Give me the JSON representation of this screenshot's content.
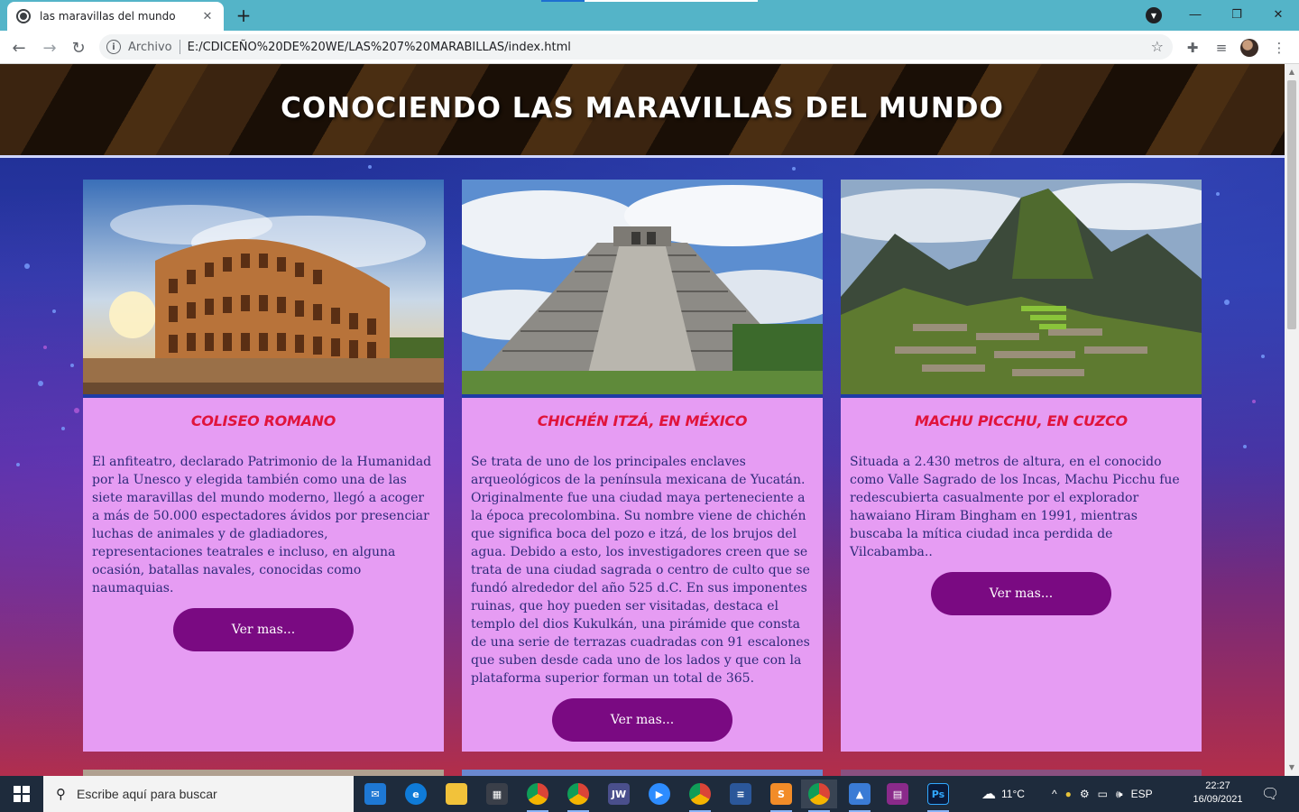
{
  "browser": {
    "tab_title": "las maravillas del mundo",
    "tab_close": "✕",
    "new_tab": "+",
    "scheme_label": "Archivo",
    "url": "E:/CDICEÑO%20DE%20WE/LAS%207%20MARABILLAS/index.html"
  },
  "page": {
    "title": "CONOCIENDO LAS MARAVILLAS DEL MUNDO",
    "cards": [
      {
        "heading": "COLISEO ROMANO",
        "text": "El anfiteatro, declarado Patrimonio de la Humanidad por la Unesco y elegida también como una de las siete maravillas del mundo moderno, llegó a acoger a más de 50.000 espectadores ávidos por presenciar luchas de animales y de gladiadores, representaciones teatrales e incluso, en alguna ocasión, batallas navales, conocidas como naumaquias.",
        "button": "Ver mas..."
      },
      {
        "heading": "CHICHÉN ITZÁ, EN MÉXICO",
        "text": "Se trata de uno de los principales enclaves arqueológicos de la península mexicana de Yucatán. Originalmente fue una ciudad maya perteneciente a la época precolombina. Su nombre viene de chichén que significa boca del pozo e itzá, de los brujos del agua. Debido a esto, los investigadores creen que se trata de una ciudad sagrada o centro de culto que se fundó alrededor del año 525 d.C. En sus imponentes ruinas, que hoy pueden ser visitadas, destaca el templo del dios Kukulkán, una pirámide que consta de una serie de terrazas cuadradas con 91 escalones que suben desde cada uno de los lados y que con la plataforma superior forman un total de 365.",
        "button": "Ver mas..."
      },
      {
        "heading": "MACHU PICCHU, EN CUZCO",
        "text": "Situada a 2.430 metros de altura, en el conocido como Valle Sagrado de los Incas, Machu Picchu fue redescubierta casualmente por el explorador hawaiano Hiram Bingham en 1991, mientras buscaba la mítica ciudad inca perdida de Vilcabamba..",
        "button": "Ver mas..."
      }
    ]
  },
  "taskbar": {
    "search_placeholder": "Escribe aquí para buscar",
    "temperature": "11°C",
    "language": "ESP",
    "time": "22:27",
    "date": "16/09/2021",
    "apps": [
      "mail-icon",
      "edge-icon",
      "file-explorer-icon",
      "store-icon",
      "chrome-icon",
      "chrome-icon",
      "jw-icon",
      "zoom-icon",
      "chrome-icon",
      "word-icon",
      "sublime-icon",
      "chrome-active-icon",
      "photos-icon",
      "winrar-icon",
      "photoshop-icon"
    ]
  },
  "colors": {
    "card_bg": "#e69cf3",
    "heading": "#e0143c",
    "button_bg": "#7a0a82",
    "body_text": "#2e2a7a"
  }
}
